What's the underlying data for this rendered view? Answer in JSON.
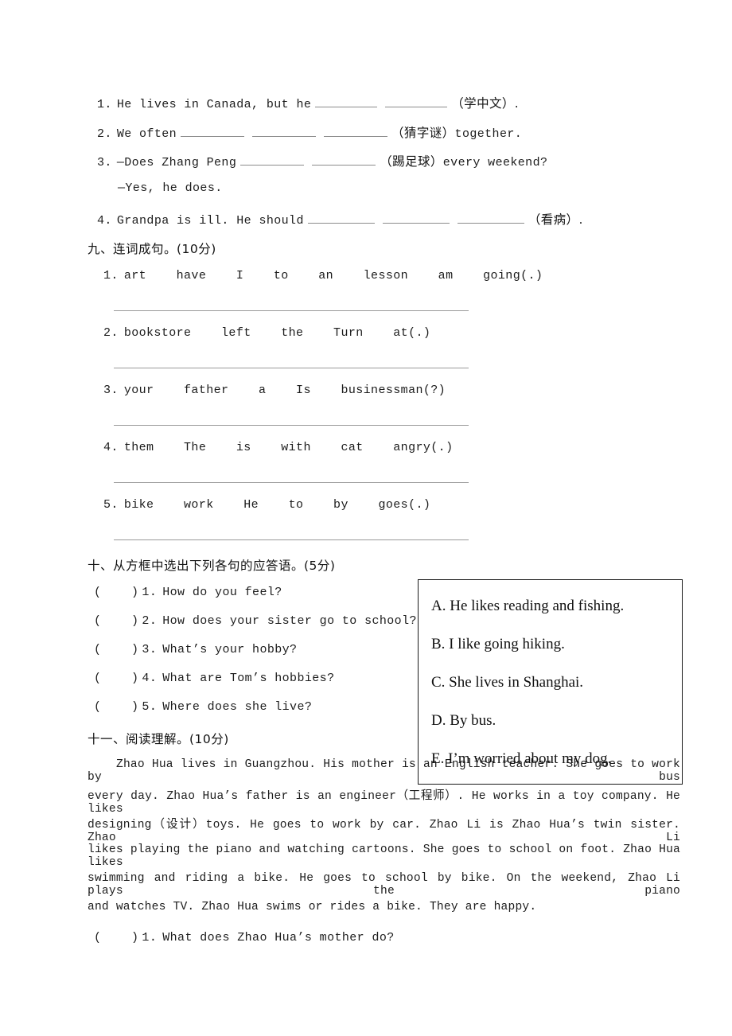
{
  "fill_in_section": {
    "items": [
      {
        "number": "1.",
        "before": "He lives in Canada, but he",
        "blanks": 2,
        "hint": "（学中文）",
        "after": "."
      },
      {
        "number": "2.",
        "before": "We often",
        "blanks": 3,
        "hint": "（猜字谜）",
        "after": "together."
      },
      {
        "number": "3.",
        "before": "—Does Zhang Peng",
        "blanks": 2,
        "hint": "（踢足球）",
        "after": "every weekend?"
      },
      {
        "number": "",
        "before": "—Yes, he does.",
        "blanks": 0,
        "hint": "",
        "after": ""
      },
      {
        "number": "4.",
        "before": "Grandpa is ill. He should",
        "blanks": 3,
        "hint": "（看病）",
        "after": "."
      }
    ]
  },
  "section_nine": {
    "heading": "九、连词成句。(10分)",
    "items": [
      {
        "number": "1.",
        "words": "art    have    I    to    an    lesson    am    going(.)"
      },
      {
        "number": "2.",
        "words": "bookstore    left    the    Turn    at(.)"
      },
      {
        "number": "3.",
        "words": "your    father    a    Is    businessman(?)"
      },
      {
        "number": "4.",
        "words": "them    The    is    with    cat    angry(.)"
      },
      {
        "number": "5.",
        "words": "bike    work    He    to    by    goes(.)"
      }
    ]
  },
  "section_ten": {
    "heading": "十、从方框中选出下列各句的应答语。(5分)",
    "questions": [
      {
        "mark": "(    )",
        "number": "1.",
        "text": "How do you feel?"
      },
      {
        "mark": "(    )",
        "number": "2.",
        "text": "How does your sister go to school?"
      },
      {
        "mark": "(    )",
        "number": "3.",
        "text": "What’s your hobby?"
      },
      {
        "mark": "(    )",
        "number": "4.",
        "text": "What are Tom’s hobbies?"
      },
      {
        "mark": "(    )",
        "number": "5.",
        "text": "Where does she live?"
      }
    ],
    "choices": [
      "A. He likes reading and fishing.",
      "B. I like going hiking.",
      "C. She lives in Shanghai.",
      "D. By bus.",
      "E. I’m worried about my dog."
    ]
  },
  "section_eleven": {
    "heading": "十一、阅读理解。(10分)",
    "passage_lines": [
      "Zhao Hua lives in Guangzhou. His mother is an English teacher. She goes to work by bus",
      "every day. Zhao Hua’s father is an engineer（工程师）. He works in a toy company. He likes",
      "designing（设计）toys. He goes to work by car. Zhao Li is Zhao Hua’s twin sister. Zhao Li",
      "likes playing the piano and watching cartoons. She goes to school on foot. Zhao Hua likes",
      "swimming and riding a bike. He goes to school by bike. On the weekend, Zhao Li plays the piano",
      "and watches TV. Zhao Hua swims or rides a bike. They are happy."
    ],
    "questions": [
      {
        "mark": "(    )",
        "number": "1.",
        "text": "What does Zhao Hua’s mother do?"
      }
    ]
  }
}
